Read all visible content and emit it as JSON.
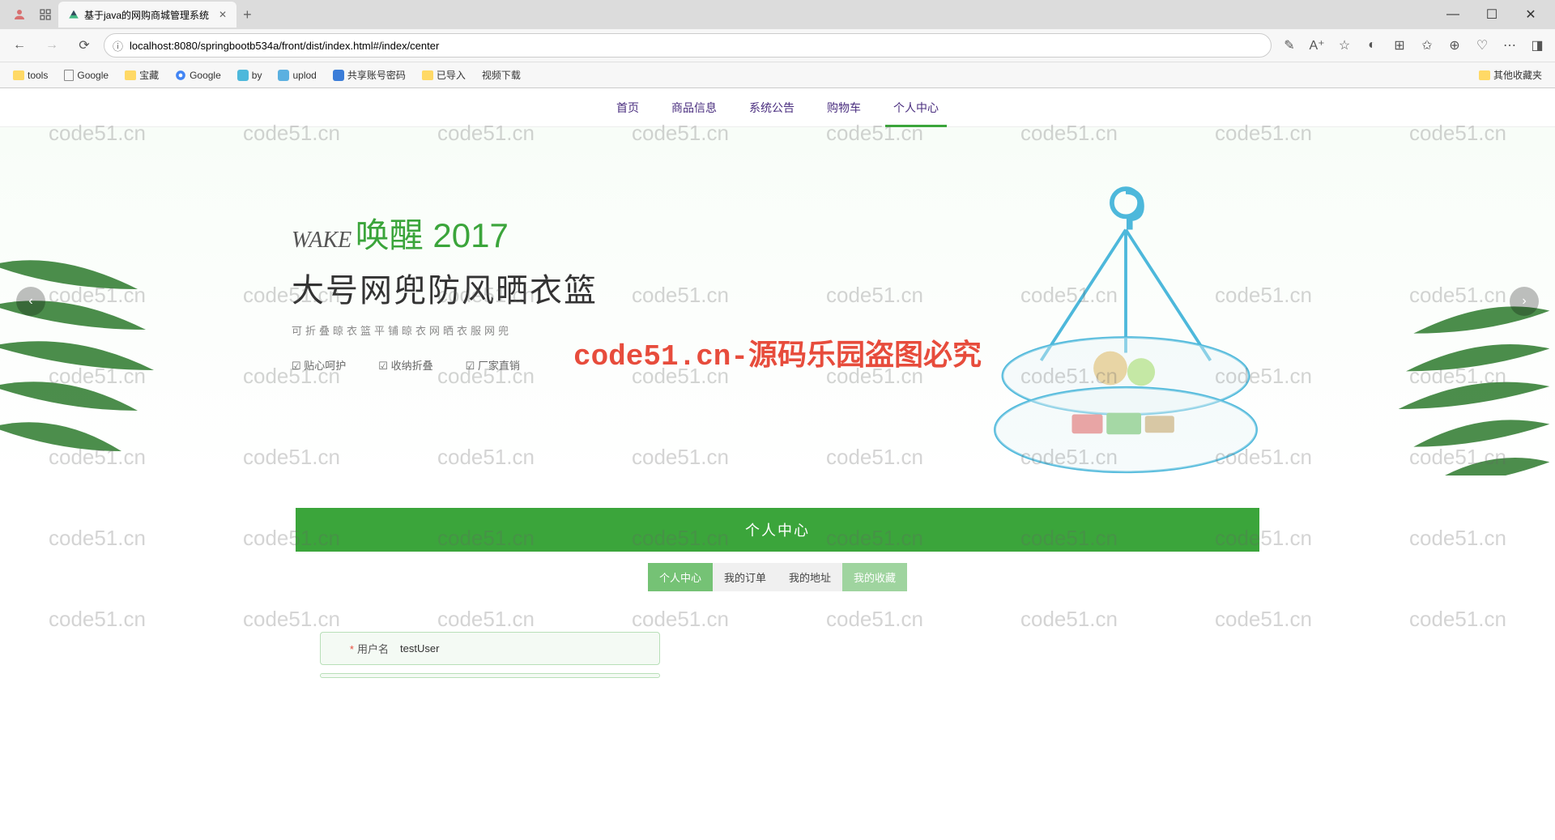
{
  "browser": {
    "tab_title": "基于java的网购商城管理系统",
    "url": "localhost:8080/springbootb534a/front/dist/index.html#/index/center",
    "bookmarks": [
      "tools",
      "Google",
      "宝藏",
      "Google",
      "by",
      "uplod",
      "共享账号密码",
      "已导入",
      "视频下载"
    ],
    "other_bookmarks": "其他收藏夹"
  },
  "nav": {
    "items": [
      "首页",
      "商品信息",
      "系统公告",
      "购物车",
      "个人中心"
    ]
  },
  "banner": {
    "wake": "WAKE",
    "title1": "唤醒 2017",
    "title2": "大号网兜防风晒衣篮",
    "subtitle": "可折叠晾衣篮平铺晾衣网晒衣服网兜",
    "checks": [
      "贴心呵护",
      "收纳折叠",
      "厂家直销"
    ]
  },
  "section": {
    "title": "个人中心",
    "tabs": [
      "个人中心",
      "我的订单",
      "我的地址",
      "我的收藏"
    ]
  },
  "form": {
    "username_label": "用户名",
    "username_value": "testUser"
  },
  "watermark": {
    "text": "code51.cn",
    "center": "code51.cn-源码乐园盗图必究"
  }
}
